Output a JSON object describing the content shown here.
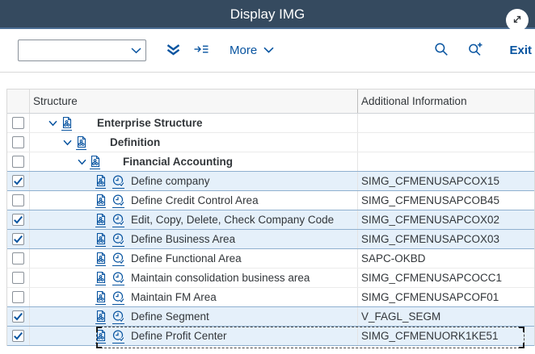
{
  "colors": {
    "shell_bar": "#354a5f",
    "accent_blue": "#0854a0",
    "selected_row_bg": "#e5f0fa",
    "selected_row_border": "#8fb0cf"
  },
  "header": {
    "title": "Display IMG",
    "expand_icon": "diagonal-resize-icon"
  },
  "toolbar": {
    "combobox": {
      "value": "",
      "placeholder": "",
      "icon": "chevron-down-icon"
    },
    "expand_all_icon": "double-chevron-down-icon",
    "goto_icon": "arrow-to-list-icon",
    "more_label": "More",
    "more_icon": "chevron-down-icon",
    "search_icon": "search-icon",
    "search_plus_icon": "search-plus-icon",
    "exit_label": "Exit"
  },
  "table": {
    "columns": [
      "Structure",
      "Additional Information"
    ],
    "row_icons": {
      "node": [
        "chevron-down-icon",
        "img-structure-node-icon"
      ],
      "activity": [
        "img-structure-node-icon",
        "img-activity-icon"
      ]
    },
    "rows": [
      {
        "type": "node",
        "level": 1,
        "label": "Enterprise Structure",
        "info": "",
        "checked": false,
        "selected": false,
        "focused": false
      },
      {
        "type": "node",
        "level": 2,
        "label": "Definition",
        "info": "",
        "checked": false,
        "selected": false,
        "focused": false
      },
      {
        "type": "node",
        "level": 3,
        "label": "Financial Accounting",
        "info": "",
        "checked": false,
        "selected": false,
        "focused": false
      },
      {
        "type": "activity",
        "level": 4,
        "label": "Define company",
        "info": "SIMG_CFMENUSAPCOX15",
        "checked": true,
        "selected": true,
        "focused": false
      },
      {
        "type": "activity",
        "level": 4,
        "label": "Define Credit Control Area",
        "info": "SIMG_CFMENUSAPCOB45",
        "checked": false,
        "selected": false,
        "focused": false
      },
      {
        "type": "activity",
        "level": 4,
        "label": "Edit, Copy, Delete, Check Company Code",
        "info": "SIMG_CFMENUSAPCOX02",
        "checked": true,
        "selected": true,
        "focused": false
      },
      {
        "type": "activity",
        "level": 4,
        "label": "Define Business Area",
        "info": "SIMG_CFMENUSAPCOX03",
        "checked": true,
        "selected": true,
        "focused": false
      },
      {
        "type": "activity",
        "level": 4,
        "label": "Define Functional Area",
        "info": "SAPC-OKBD",
        "checked": false,
        "selected": false,
        "focused": false
      },
      {
        "type": "activity",
        "level": 4,
        "label": "Maintain consolidation business area",
        "info": "SIMG_CFMENUSAPCOCC1",
        "checked": false,
        "selected": false,
        "focused": false
      },
      {
        "type": "activity",
        "level": 4,
        "label": "Maintain FM Area",
        "info": "SIMG_CFMENUSAPCOF01",
        "checked": false,
        "selected": false,
        "focused": false
      },
      {
        "type": "activity",
        "level": 4,
        "label": "Define Segment",
        "info": "V_FAGL_SEGM",
        "checked": true,
        "selected": true,
        "focused": false
      },
      {
        "type": "activity",
        "level": 4,
        "label": "Define Profit Center",
        "info": "SIMG_CFMENUORK1KE51",
        "checked": true,
        "selected": true,
        "focused": true
      }
    ]
  }
}
